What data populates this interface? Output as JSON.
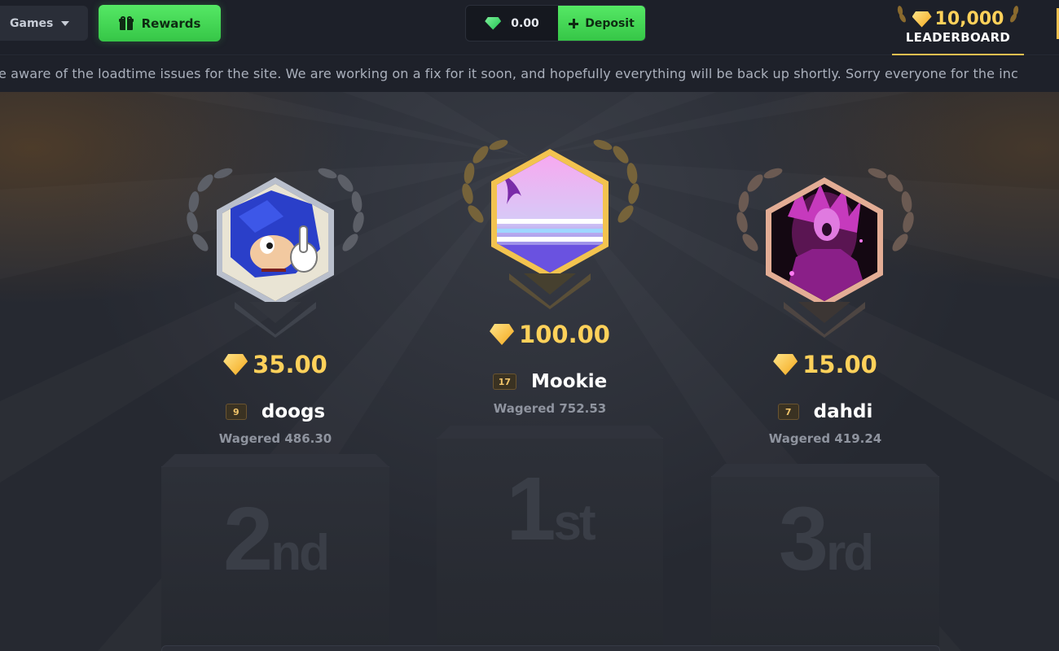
{
  "header": {
    "games_label": "Games",
    "rewards_label": "Rewards",
    "balance": "0.00",
    "deposit_label": "Deposit",
    "leaderboard_prize": "10,000",
    "leaderboard_label": "LEADERBOARD"
  },
  "announcement": "e aware of the loadtime issues for the site. We are working on a fix for it soon, and hopefully everything will be back up shortly. Sorry everyone for the inc",
  "podium": [
    {
      "place_num": "2",
      "place_suffix": "nd",
      "prize": "35.00",
      "level": "9",
      "name": "doogs",
      "wagered": "Wagered 486.30",
      "frame_color": "#b9bfcc"
    },
    {
      "place_num": "1",
      "place_suffix": "st",
      "prize": "100.00",
      "level": "17",
      "name": "Mookie",
      "wagered": "Wagered 752.53",
      "frame_color": "#f3c34f"
    },
    {
      "place_num": "3",
      "place_suffix": "rd",
      "prize": "15.00",
      "level": "7",
      "name": "dahdi",
      "wagered": "Wagered 419.24",
      "frame_color": "#e3ad95"
    }
  ],
  "colors": {
    "accent_green": "#45d856",
    "gold": "#ffd15a",
    "background": "#1c1f27"
  },
  "icons": [
    "chevron-down-icon",
    "gift-icon",
    "gem-icon",
    "plus-icon",
    "laurel-icon"
  ]
}
